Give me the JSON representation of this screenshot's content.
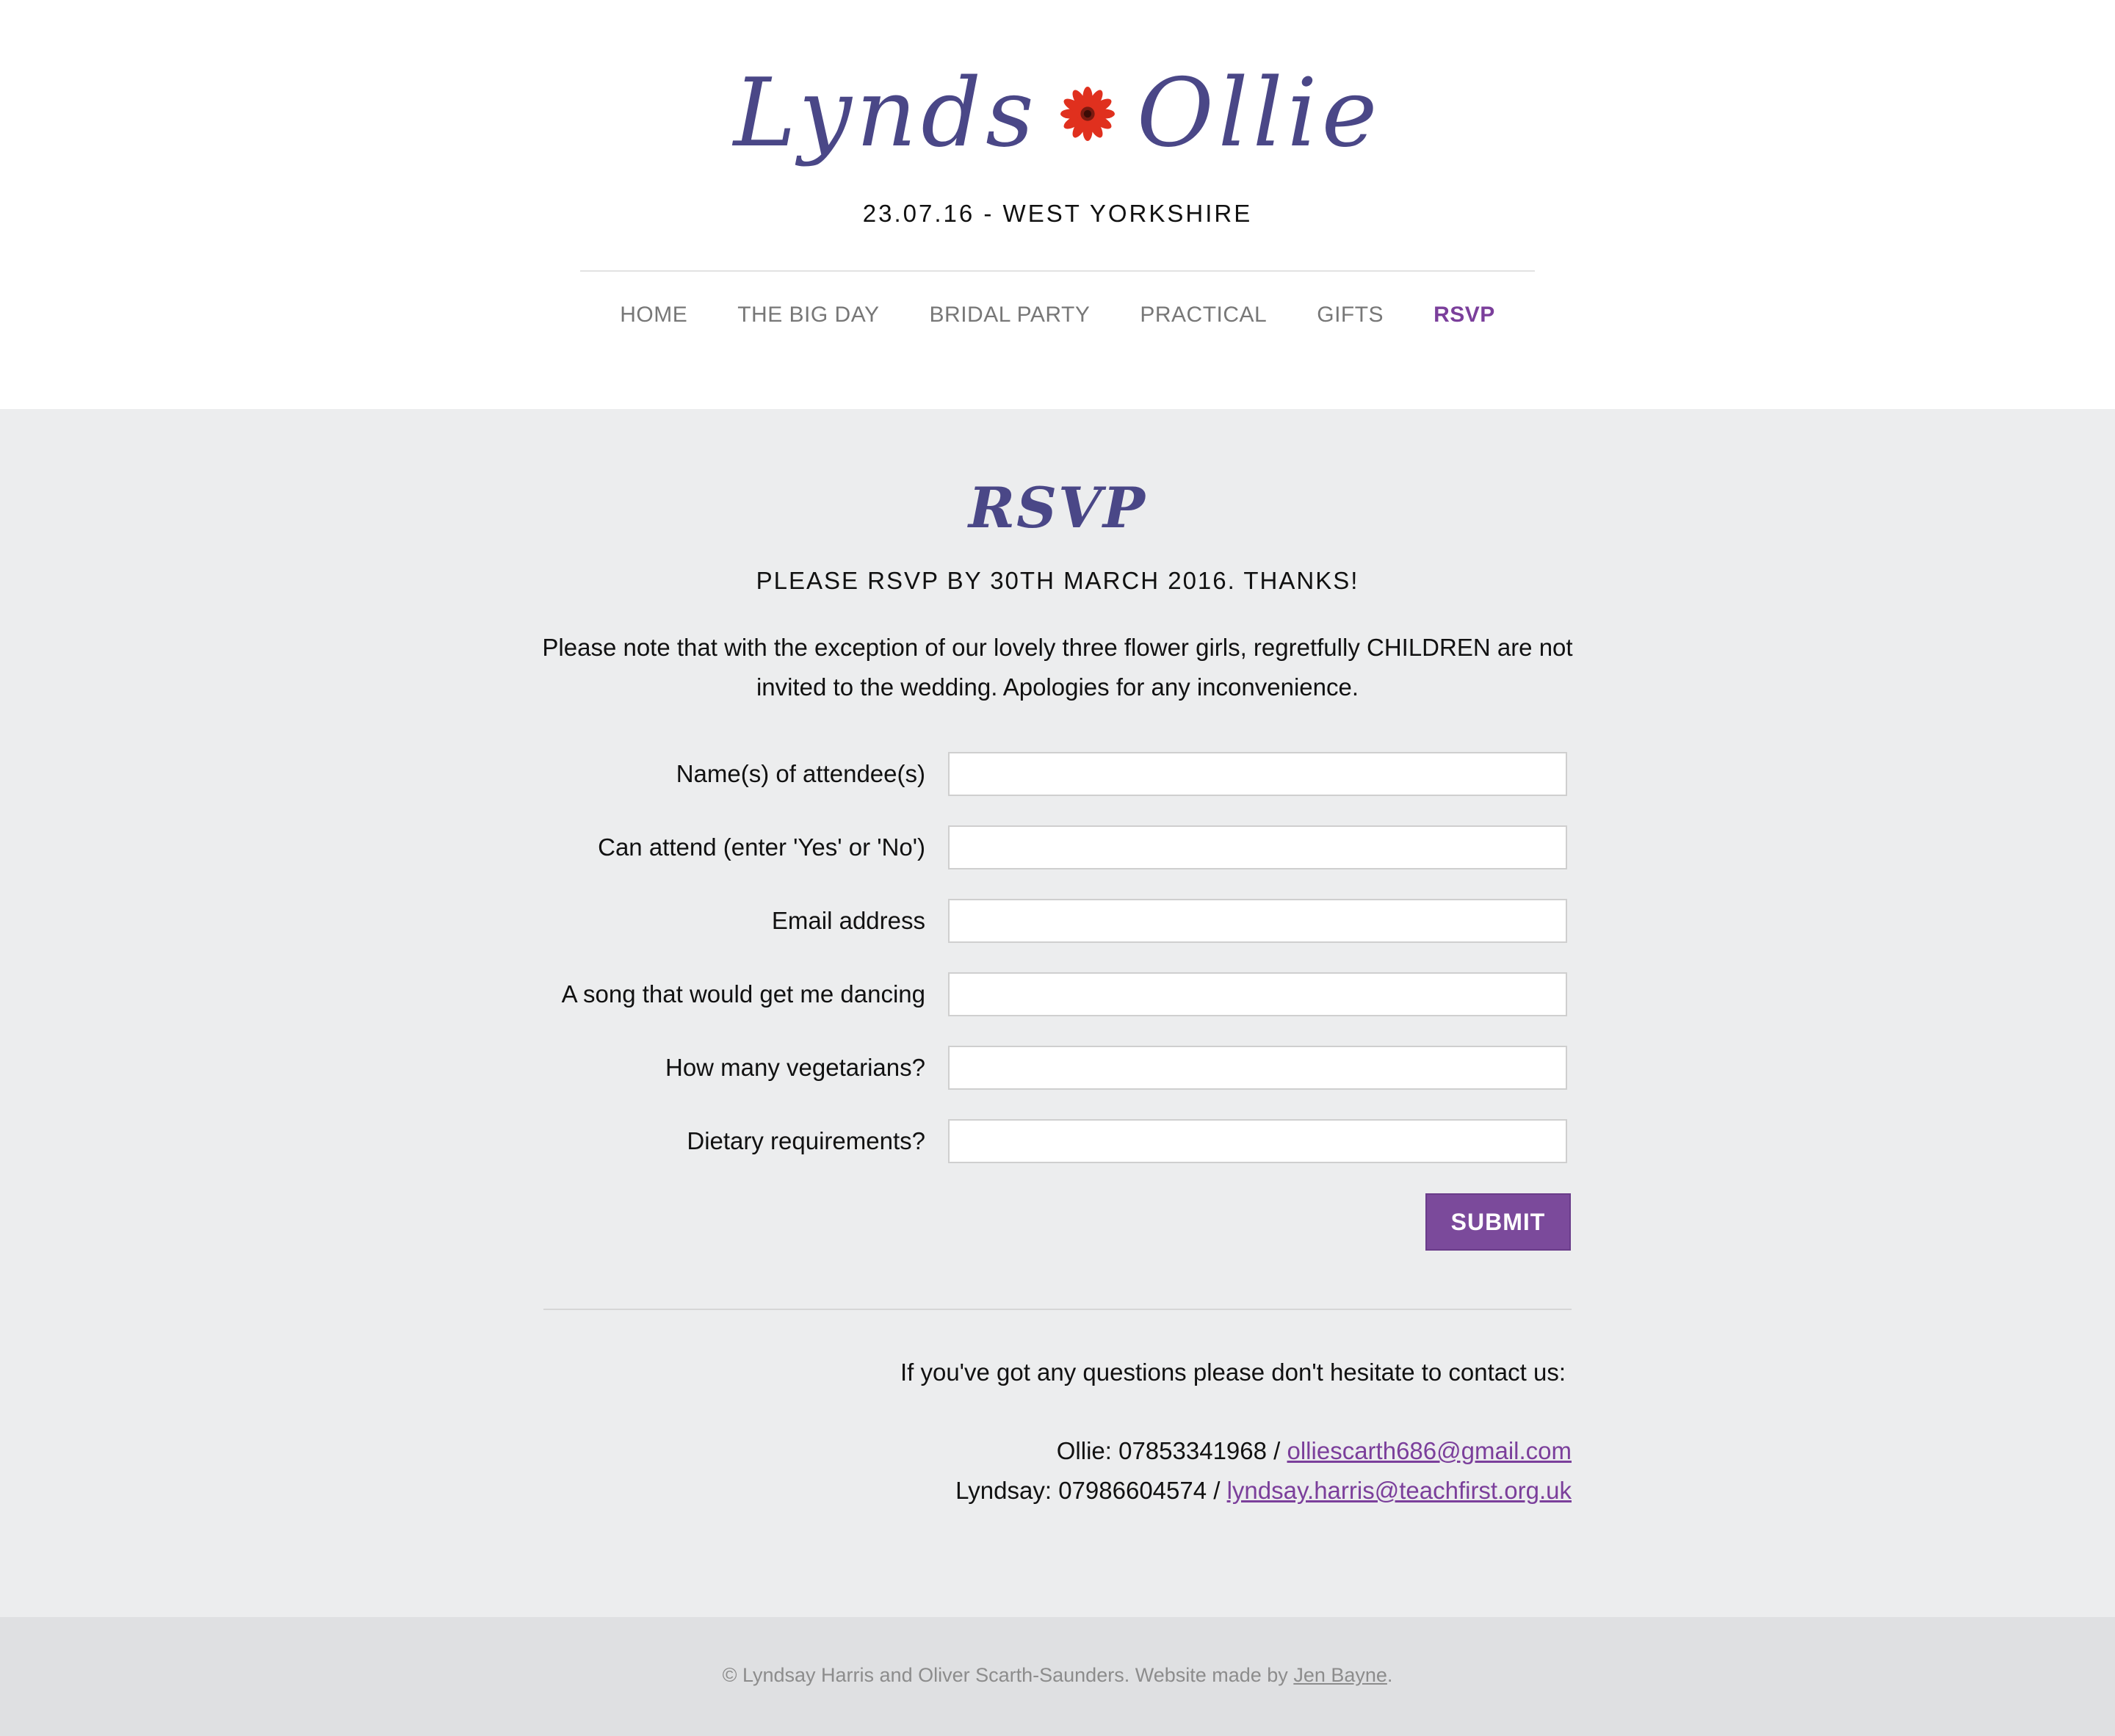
{
  "header": {
    "logo_left": "Lynds",
    "logo_right": "Ollie",
    "tagline": "23.07.16 - WEST YORKSHIRE"
  },
  "nav": {
    "items": [
      {
        "label": "HOME"
      },
      {
        "label": "THE BIG DAY"
      },
      {
        "label": "BRIDAL PARTY"
      },
      {
        "label": "PRACTICAL"
      },
      {
        "label": "GIFTS"
      },
      {
        "label": "RSVP"
      }
    ],
    "active": "RSVP"
  },
  "rsvp": {
    "title": "RSVP",
    "deadline": "PLEASE RSVP BY 30TH MARCH 2016. THANKS!",
    "note": "Please note that with the exception of our lovely three flower girls, regretfully CHILDREN are not invited to the wedding. Apologies for any inconvenience.",
    "fields": [
      {
        "label": "Name(s) of attendee(s)",
        "value": ""
      },
      {
        "label": "Can attend (enter 'Yes' or 'No')",
        "value": ""
      },
      {
        "label": "Email address",
        "value": ""
      },
      {
        "label": "A song that would get me dancing",
        "value": ""
      },
      {
        "label": "How many vegetarians?",
        "value": ""
      },
      {
        "label": "Dietary requirements?",
        "value": ""
      }
    ],
    "submit_label": "SUBMIT"
  },
  "contact": {
    "intro": "If you've got any questions please don't hesitate to contact us:",
    "ollie_prefix": "Ollie: 07853341968 / ",
    "ollie_email": "olliescarth686@gmail.com",
    "lyndsay_prefix": "Lyndsay: 07986604574 / ",
    "lyndsay_email": "lyndsay.harris@teachfirst.org.uk"
  },
  "footer": {
    "text": "© Lyndsay Harris and Oliver Scarth-Saunders. Website made by ",
    "link": "Jen Bayne",
    "end": "."
  },
  "colors": {
    "brand_purple": "#7b3f9b",
    "logo_navy": "#4a4787",
    "flower_red": "#e0301e",
    "main_bg": "#ecedee",
    "footer_bg": "#dfe0e2"
  }
}
